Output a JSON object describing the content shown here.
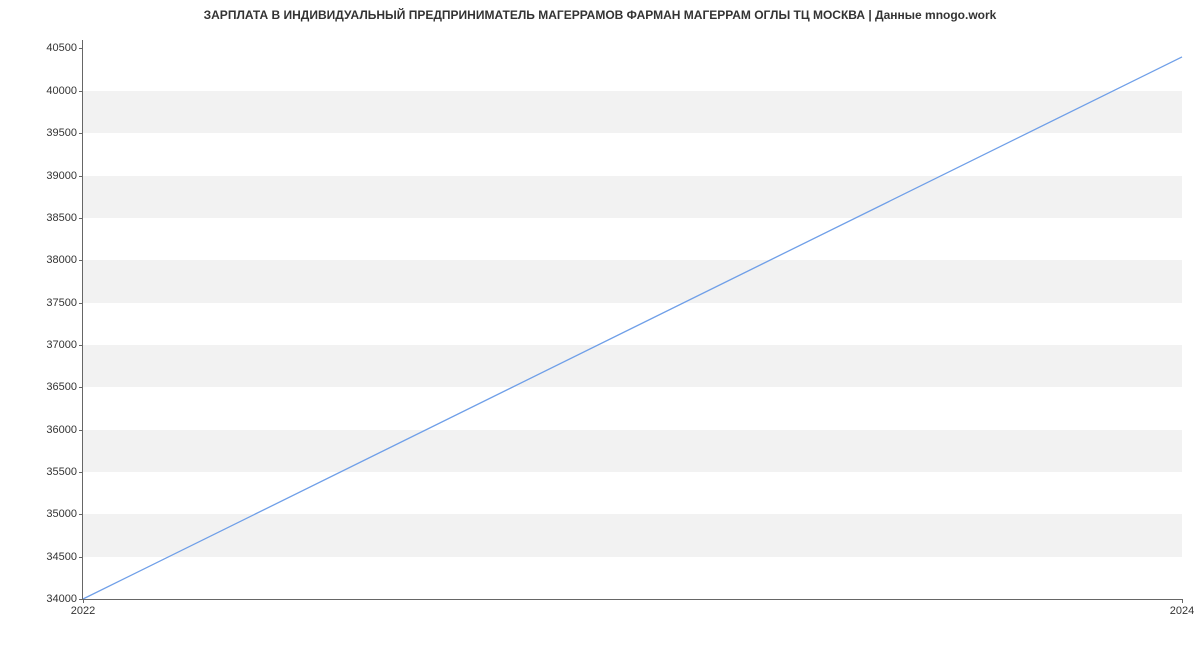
{
  "chart_data": {
    "type": "line",
    "title": "ЗАРПЛАТА В ИНДИВИДУАЛЬНЫЙ ПРЕДПРИНИМАТЕЛЬ МАГЕРРАМОВ ФАРМАН МАГЕРРАМ ОГЛЫ ТЦ МОСКВА | Данные mnogo.work",
    "x": [
      2022,
      2024
    ],
    "values": [
      34000,
      40400
    ],
    "xlabel": "",
    "ylabel": "",
    "x_ticks": [
      2022,
      2024
    ],
    "y_ticks": [
      34000,
      34500,
      35000,
      35500,
      36000,
      36500,
      37000,
      37500,
      38000,
      38500,
      39000,
      39500,
      40000,
      40500
    ],
    "xlim": [
      2022,
      2024
    ],
    "ylim": [
      34000,
      40600
    ],
    "line_color": "#6f9fe8",
    "band_color": "#f2f2f2"
  }
}
